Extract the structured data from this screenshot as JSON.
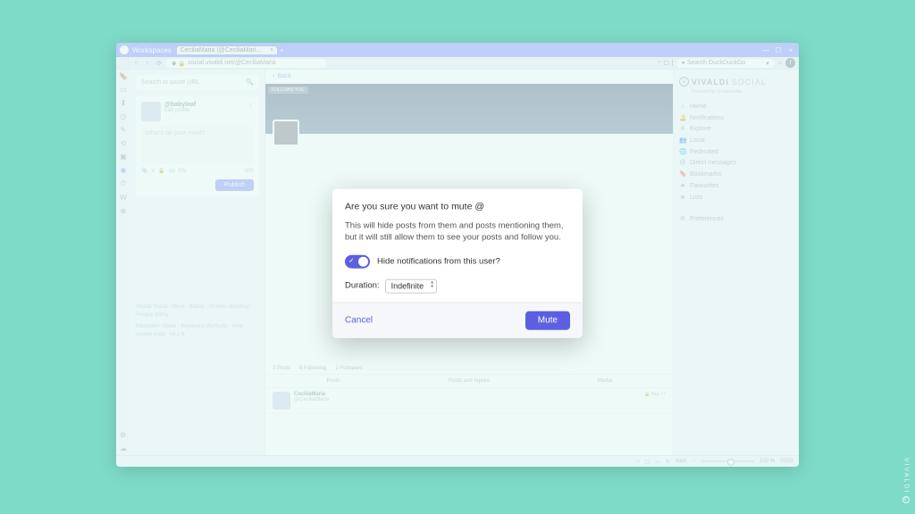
{
  "titlebar": {
    "workspaces": "Workspaces",
    "tab_label": "CeciliaMaria (@CeciliaMari...",
    "plus": "+"
  },
  "addr": {
    "url": "social.vivaldi.net/@CeciliaMaria",
    "search_placeholder": "Search DuckDuckGo"
  },
  "left": {
    "search_placeholder": "Search or paste URL",
    "username": "@babyleaf",
    "edit_profile": "Edit profile",
    "compose_placeholder": "What's on your mind?",
    "char_count": "500",
    "publish": "Publish",
    "footer1": "Vivaldi Social: About · Status · Profiles directory · Privacy policy",
    "footer2": "Mastodon: About · Keyboard shortcuts · View source code · v4.1.6"
  },
  "mid": {
    "back": "Back",
    "follow_tag": "FOLLOWS YOU",
    "stats": {
      "posts": "3 Posts",
      "following": "8 Following",
      "followers": "2 Followers"
    },
    "tabs": {
      "posts": "Posts",
      "replies": "Posts and replies",
      "media": "Media"
    },
    "post": {
      "name": "CeciliaMaria",
      "handle": "@CeciliaMaria",
      "date": "May 17"
    }
  },
  "right": {
    "brand_v": "VIVALDI",
    "brand_s": "SOCIAL",
    "powered": "Powered by",
    "mastodon": "mastodon",
    "items": {
      "home": "Home",
      "notifications": "Notifications",
      "explore": "Explore",
      "local": "Local",
      "federated": "Federated",
      "dm": "Direct messages",
      "bookmarks": "Bookmarks",
      "favourites": "Favourites",
      "lists": "Lists",
      "prefs": "Preferences"
    }
  },
  "status": {
    "next": "Next",
    "zoom": "100 %",
    "count": "20/01"
  },
  "modal": {
    "title": "Are you sure you want to mute @",
    "desc": "This will hide posts from them and posts mentioning them, but it will still allow them to see your posts and follow you.",
    "toggle_label": "Hide notifications from this user?",
    "duration_label": "Duration:",
    "duration_value": "Indefinite",
    "cancel": "Cancel",
    "confirm": "Mute"
  },
  "watermark": "VIVALDI"
}
